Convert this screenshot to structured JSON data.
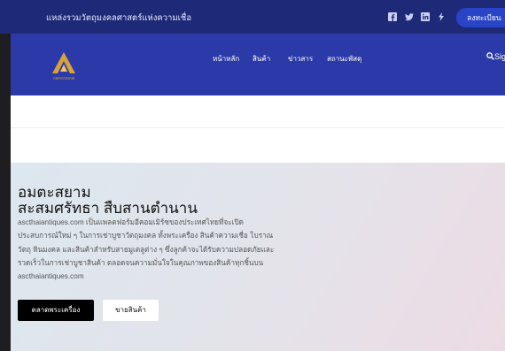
{
  "topbar": {
    "title": "แหล่งรวมวัตถุมงคลศาสตร์แห่งความเชื่อ",
    "social_icons": [
      "facebook-icon",
      "twitter-icon",
      "linkedin-icon",
      "link-icon"
    ],
    "register_label": "ลงทะเบียน",
    "colors": {
      "background": "#1e2a78",
      "register": "#2a44c8"
    }
  },
  "navbar": {
    "logo_text": "AMAYASIAM",
    "items": [
      "หน้าหลัก",
      "สินค้า",
      "ข่าวสาร",
      "สถานะพัสดุ"
    ],
    "search_label": "Sig",
    "colors": {
      "background": "#2b3aa8",
      "logo_gold": "#d8a23a"
    }
  },
  "hero": {
    "heading_line1": "อมตะสยาม",
    "heading_line2": "สะสมศรัทธา สืบสานตำนาน",
    "description": "ascthaiantiques.com เป็นแพลตฟอร์มอีคอมเมิร์ซของประเทศไทยที่จะเปิดประสบการณ์ใหม่ ๆ ในการเช่าบูชาวัตถุมงคล ทั้งพระเครื่อง สินค้าความเชื่อ โบราณวัตถุ หินมงคล และสินค้าสำหรับสายมูเตลูต่าง ๆ ซึ่งลูกค้าจะได้รับความปลอดภัยและรวดเร็วในการเช่าบูชาสินค้า ตลอดจนความมั่นใจในคุณภาพของสินค้าทุกชิ้นบน ascthaiantiques.com",
    "primary_button": "ตลาดพระเครื่อง",
    "secondary_button": "ขายสินค้า"
  }
}
